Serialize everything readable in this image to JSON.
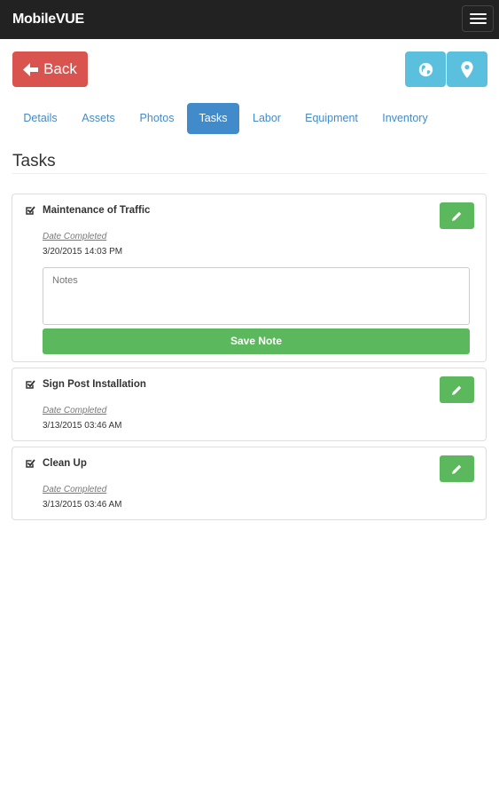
{
  "app": {
    "brand": "MobileVUE"
  },
  "header": {
    "back_label": "Back",
    "globe_icon": "globe-icon",
    "location_icon": "map-marker-icon"
  },
  "tabs": [
    {
      "label": "Details",
      "active": false
    },
    {
      "label": "Assets",
      "active": false
    },
    {
      "label": "Photos",
      "active": false
    },
    {
      "label": "Tasks",
      "active": true
    },
    {
      "label": "Labor",
      "active": false
    },
    {
      "label": "Equipment",
      "active": false
    },
    {
      "label": "Inventory",
      "active": false
    }
  ],
  "page": {
    "title": "Tasks"
  },
  "tasks": [
    {
      "name": "Maintenance of Traffic",
      "date_label": "Date Completed",
      "date": "3/20/2015 14:03 PM",
      "notes_placeholder": "Notes",
      "save_label": "Save Note"
    },
    {
      "name": "Sign Post Installation",
      "date_label": "Date Completed",
      "date": "3/13/2015 03:46 AM"
    },
    {
      "name": "Clean Up",
      "date_label": "Date Completed",
      "date": "3/13/2015 03:46 AM"
    }
  ],
  "colors": {
    "navbar": "#222222",
    "back": "#d9534f",
    "info": "#5bc0de",
    "primary": "#428bca",
    "success": "#5cb85c"
  }
}
